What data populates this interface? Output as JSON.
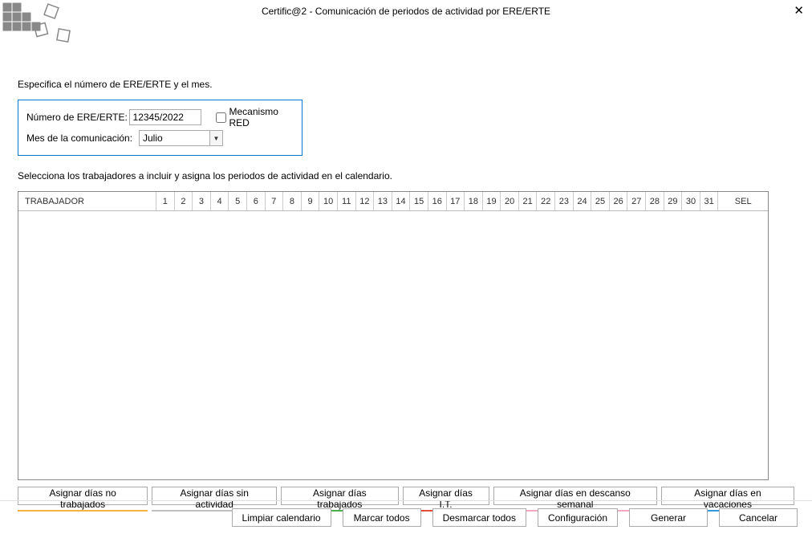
{
  "window": {
    "title": "Certific@2 - Comunicación de periodos de actividad por ERE/ERTE"
  },
  "instructions": {
    "top": "Especifica el número de ERE/ERTE y el mes.",
    "grid": "Selecciona los trabajadores a incluir y asigna los periodos de actividad en el calendario."
  },
  "form": {
    "ere_label": "Número de ERE/ERTE:",
    "ere_value": "12345/2022",
    "red_label": "Mecanismo RED",
    "month_label": "Mes de la comunicación:",
    "month_value": "Julio"
  },
  "grid": {
    "worker_header": "TRABAJADOR",
    "sel_header": "SEL",
    "days": [
      "1",
      "2",
      "3",
      "4",
      "5",
      "6",
      "7",
      "8",
      "9",
      "10",
      "11",
      "12",
      "13",
      "14",
      "15",
      "16",
      "17",
      "18",
      "19",
      "20",
      "21",
      "22",
      "23",
      "24",
      "25",
      "26",
      "27",
      "28",
      "29",
      "30",
      "31"
    ]
  },
  "assign_buttons": [
    {
      "label": "Asignar días no trabajados",
      "color": "#f5b041"
    },
    {
      "label": "Asignar días sin actividad",
      "color": "#bfbfbf"
    },
    {
      "label": "Asignar días trabajados",
      "color": "#4caf50"
    },
    {
      "label": "Asignar días I.T.",
      "color": "#e74c3c"
    },
    {
      "label": "Asignar días en descanso semanal",
      "color": "#f5a6c0"
    },
    {
      "label": "Asignar días en vacaciones",
      "color": "#3498db"
    }
  ],
  "bottom_buttons": {
    "clear": "Limpiar calendario",
    "mark_all": "Marcar todos",
    "unmark_all": "Desmarcar todos",
    "config": "Configuración",
    "generate": "Generar",
    "cancel": "Cancelar"
  }
}
